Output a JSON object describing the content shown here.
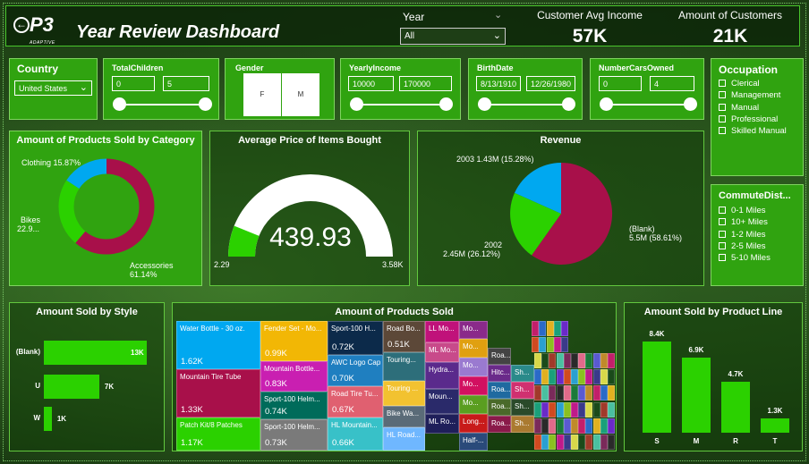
{
  "header": {
    "logo": "P3",
    "logo_sub": "ADAPTIVE",
    "title": "Year Review Dashboard",
    "year_label": "Year",
    "year_value": "All",
    "kpi_income_label": "Customer Avg Income",
    "kpi_income_value": "57K",
    "kpi_customers_label": "Amount of Customers",
    "kpi_customers_value": "21K"
  },
  "filters": {
    "country_label": "Country",
    "country_value": "United States",
    "children_label": "TotalChildren",
    "children_min": "0",
    "children_max": "5",
    "gender_label": "Gender",
    "gender_f": "F",
    "gender_m": "M",
    "income_label": "YearlyIncome",
    "income_min": "10000",
    "income_max": "170000",
    "birth_label": "BirthDate",
    "birth_min": "8/13/1910",
    "birth_max": "12/26/1980",
    "cars_label": "NumberCarsOwned",
    "cars_min": "0",
    "cars_max": "4",
    "occupation_label": "Occupation",
    "occupation_items": [
      "Clerical",
      "Management",
      "Manual",
      "Professional",
      "Skilled Manual"
    ],
    "commute_label": "CommuteDist...",
    "commute_items": [
      "0-1 Miles",
      "10+ Miles",
      "1-2 Miles",
      "2-5 Miles",
      "5-10 Miles"
    ]
  },
  "donut": {
    "title": "Amount of Products Sold by Category",
    "label_clothing": "Clothing 15.87%",
    "label_bikes_1": "Bikes",
    "label_bikes_2": "22.9...",
    "label_acc_1": "Accessories",
    "label_acc_2": "61.14%"
  },
  "gauge": {
    "title": "Average Price of Items Bought",
    "value": "439.93",
    "min": "2.29",
    "max": "3.58K",
    "fraction": 0.122
  },
  "pie": {
    "title": "Revenue",
    "label_2003": "2003 1.43M (15.28%)",
    "label_2002_1": "2002",
    "label_2002_2": "2.45M (26.12%)",
    "label_blank_1": "(Blank)",
    "label_blank_2": "5.5M (58.61%)"
  },
  "style_chart": {
    "title": "Amount Sold by Style",
    "rows": [
      {
        "label": "(Blank)",
        "value": "13K"
      },
      {
        "label": "U",
        "value": "7K"
      },
      {
        "label": "W",
        "value": "1K"
      }
    ]
  },
  "treemap": {
    "title": "Amount of Products Sold",
    "items": [
      {
        "label": "Water Bottle - 30 oz.",
        "value": "1.62K"
      },
      {
        "label": "Mountain Tire Tube",
        "value": "1.33K"
      },
      {
        "label": "Patch Kit/8 Patches",
        "value": "1.17K"
      },
      {
        "label": "Fender Set - Mo...",
        "value": "0.99K"
      },
      {
        "label": "Mountain Bottle...",
        "value": "0.83K"
      },
      {
        "label": "Sport-100 Helm...",
        "value": "0.74K"
      },
      {
        "label": "Sport-100 Helm...",
        "value": "0.73K"
      },
      {
        "label": "Sport-100 H...",
        "value": "0.72K"
      },
      {
        "label": "AWC Logo Cap",
        "value": "0.70K"
      },
      {
        "label": "Road Tire Tu...",
        "value": "0.67K"
      },
      {
        "label": "HL Mountain...",
        "value": "0.66K"
      },
      {
        "label": "Road Bo...",
        "value": "0.51K"
      },
      {
        "label": "LL Mo...",
        "value": ""
      },
      {
        "label": "ML Mo...",
        "value": ""
      },
      {
        "label": "Touring...",
        "value": ""
      },
      {
        "label": "Touring ...",
        "value": ""
      },
      {
        "label": "Hydra...",
        "value": ""
      },
      {
        "label": "Bike Wa...",
        "value": ""
      },
      {
        "label": "Moun...",
        "value": ""
      },
      {
        "label": "HL Road...",
        "value": ""
      },
      {
        "label": "ML Ro...",
        "value": ""
      },
      {
        "label": "Mo...",
        "value": ""
      },
      {
        "label": "Mo...",
        "value": ""
      },
      {
        "label": "Mo...",
        "value": ""
      },
      {
        "label": "Mo...",
        "value": ""
      },
      {
        "label": "Mo...",
        "value": ""
      },
      {
        "label": "Long...",
        "value": ""
      },
      {
        "label": "Half-...",
        "value": ""
      },
      {
        "label": "Roa...",
        "value": ""
      },
      {
        "label": "Hitc...",
        "value": ""
      },
      {
        "label": "Roa...",
        "value": ""
      },
      {
        "label": "Roa...",
        "value": ""
      },
      {
        "label": "Roa...",
        "value": ""
      },
      {
        "label": "Sh...",
        "value": ""
      },
      {
        "label": "Sh...",
        "value": ""
      },
      {
        "label": "Sh...",
        "value": ""
      },
      {
        "label": "Sh...",
        "value": ""
      }
    ]
  },
  "line_chart": {
    "title": "Amount Sold by Product Line",
    "bars": [
      {
        "label": "S",
        "value": "8.4K",
        "num": 8.4
      },
      {
        "label": "M",
        "value": "6.9K",
        "num": 6.9
      },
      {
        "label": "R",
        "value": "4.7K",
        "num": 4.7
      },
      {
        "label": "T",
        "value": "1.3K",
        "num": 1.3
      }
    ]
  },
  "chart_data": [
    {
      "type": "pie",
      "title": "Amount of Products Sold by Category",
      "categories": [
        "Accessories",
        "Bikes",
        "Clothing"
      ],
      "values": [
        61.14,
        22.9,
        15.87
      ]
    },
    {
      "type": "pie",
      "title": "Revenue",
      "categories": [
        "(Blank)",
        "2002",
        "2003"
      ],
      "values": [
        5.5,
        2.45,
        1.43
      ],
      "percent": [
        58.61,
        26.12,
        15.28
      ]
    },
    {
      "type": "bar",
      "title": "Amount Sold by Style",
      "categories": [
        "(Blank)",
        "U",
        "W"
      ],
      "values": [
        13,
        7,
        1
      ]
    },
    {
      "type": "bar",
      "title": "Amount Sold by Product Line",
      "categories": [
        "S",
        "M",
        "R",
        "T"
      ],
      "values": [
        8.4,
        6.9,
        4.7,
        1.3
      ]
    }
  ],
  "colors": {
    "panel": "#30a310",
    "accent_green": "#2bd100",
    "crimson": "#a8104a",
    "sky": "#00a8f0"
  }
}
